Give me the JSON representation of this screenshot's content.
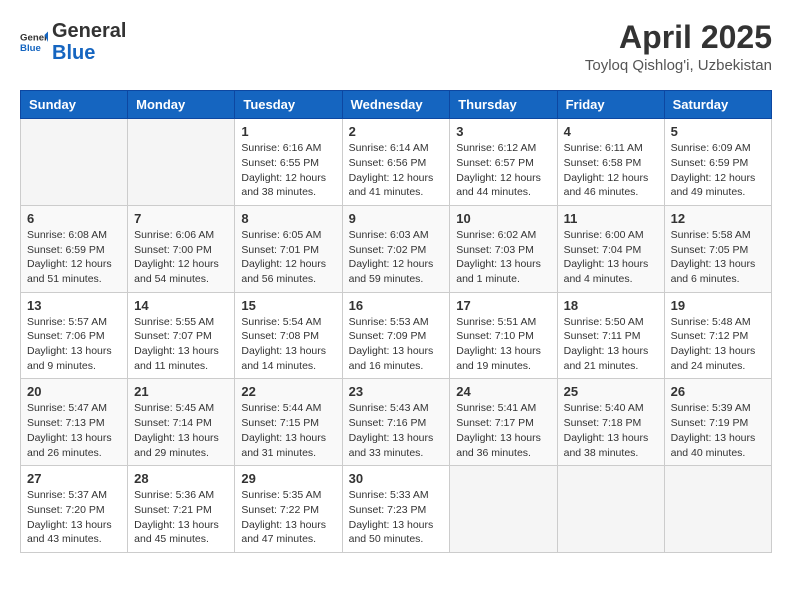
{
  "logo": {
    "general": "General",
    "blue": "Blue"
  },
  "title": "April 2025",
  "location": "Toyloq Qishlog'i, Uzbekistan",
  "weekdays": [
    "Sunday",
    "Monday",
    "Tuesday",
    "Wednesday",
    "Thursday",
    "Friday",
    "Saturday"
  ],
  "weeks": [
    [
      {
        "day": "",
        "detail": ""
      },
      {
        "day": "",
        "detail": ""
      },
      {
        "day": "1",
        "detail": "Sunrise: 6:16 AM\nSunset: 6:55 PM\nDaylight: 12 hours and 38 minutes."
      },
      {
        "day": "2",
        "detail": "Sunrise: 6:14 AM\nSunset: 6:56 PM\nDaylight: 12 hours and 41 minutes."
      },
      {
        "day": "3",
        "detail": "Sunrise: 6:12 AM\nSunset: 6:57 PM\nDaylight: 12 hours and 44 minutes."
      },
      {
        "day": "4",
        "detail": "Sunrise: 6:11 AM\nSunset: 6:58 PM\nDaylight: 12 hours and 46 minutes."
      },
      {
        "day": "5",
        "detail": "Sunrise: 6:09 AM\nSunset: 6:59 PM\nDaylight: 12 hours and 49 minutes."
      }
    ],
    [
      {
        "day": "6",
        "detail": "Sunrise: 6:08 AM\nSunset: 6:59 PM\nDaylight: 12 hours and 51 minutes."
      },
      {
        "day": "7",
        "detail": "Sunrise: 6:06 AM\nSunset: 7:00 PM\nDaylight: 12 hours and 54 minutes."
      },
      {
        "day": "8",
        "detail": "Sunrise: 6:05 AM\nSunset: 7:01 PM\nDaylight: 12 hours and 56 minutes."
      },
      {
        "day": "9",
        "detail": "Sunrise: 6:03 AM\nSunset: 7:02 PM\nDaylight: 12 hours and 59 minutes."
      },
      {
        "day": "10",
        "detail": "Sunrise: 6:02 AM\nSunset: 7:03 PM\nDaylight: 13 hours and 1 minute."
      },
      {
        "day": "11",
        "detail": "Sunrise: 6:00 AM\nSunset: 7:04 PM\nDaylight: 13 hours and 4 minutes."
      },
      {
        "day": "12",
        "detail": "Sunrise: 5:58 AM\nSunset: 7:05 PM\nDaylight: 13 hours and 6 minutes."
      }
    ],
    [
      {
        "day": "13",
        "detail": "Sunrise: 5:57 AM\nSunset: 7:06 PM\nDaylight: 13 hours and 9 minutes."
      },
      {
        "day": "14",
        "detail": "Sunrise: 5:55 AM\nSunset: 7:07 PM\nDaylight: 13 hours and 11 minutes."
      },
      {
        "day": "15",
        "detail": "Sunrise: 5:54 AM\nSunset: 7:08 PM\nDaylight: 13 hours and 14 minutes."
      },
      {
        "day": "16",
        "detail": "Sunrise: 5:53 AM\nSunset: 7:09 PM\nDaylight: 13 hours and 16 minutes."
      },
      {
        "day": "17",
        "detail": "Sunrise: 5:51 AM\nSunset: 7:10 PM\nDaylight: 13 hours and 19 minutes."
      },
      {
        "day": "18",
        "detail": "Sunrise: 5:50 AM\nSunset: 7:11 PM\nDaylight: 13 hours and 21 minutes."
      },
      {
        "day": "19",
        "detail": "Sunrise: 5:48 AM\nSunset: 7:12 PM\nDaylight: 13 hours and 24 minutes."
      }
    ],
    [
      {
        "day": "20",
        "detail": "Sunrise: 5:47 AM\nSunset: 7:13 PM\nDaylight: 13 hours and 26 minutes."
      },
      {
        "day": "21",
        "detail": "Sunrise: 5:45 AM\nSunset: 7:14 PM\nDaylight: 13 hours and 29 minutes."
      },
      {
        "day": "22",
        "detail": "Sunrise: 5:44 AM\nSunset: 7:15 PM\nDaylight: 13 hours and 31 minutes."
      },
      {
        "day": "23",
        "detail": "Sunrise: 5:43 AM\nSunset: 7:16 PM\nDaylight: 13 hours and 33 minutes."
      },
      {
        "day": "24",
        "detail": "Sunrise: 5:41 AM\nSunset: 7:17 PM\nDaylight: 13 hours and 36 minutes."
      },
      {
        "day": "25",
        "detail": "Sunrise: 5:40 AM\nSunset: 7:18 PM\nDaylight: 13 hours and 38 minutes."
      },
      {
        "day": "26",
        "detail": "Sunrise: 5:39 AM\nSunset: 7:19 PM\nDaylight: 13 hours and 40 minutes."
      }
    ],
    [
      {
        "day": "27",
        "detail": "Sunrise: 5:37 AM\nSunset: 7:20 PM\nDaylight: 13 hours and 43 minutes."
      },
      {
        "day": "28",
        "detail": "Sunrise: 5:36 AM\nSunset: 7:21 PM\nDaylight: 13 hours and 45 minutes."
      },
      {
        "day": "29",
        "detail": "Sunrise: 5:35 AM\nSunset: 7:22 PM\nDaylight: 13 hours and 47 minutes."
      },
      {
        "day": "30",
        "detail": "Sunrise: 5:33 AM\nSunset: 7:23 PM\nDaylight: 13 hours and 50 minutes."
      },
      {
        "day": "",
        "detail": ""
      },
      {
        "day": "",
        "detail": ""
      },
      {
        "day": "",
        "detail": ""
      }
    ]
  ]
}
